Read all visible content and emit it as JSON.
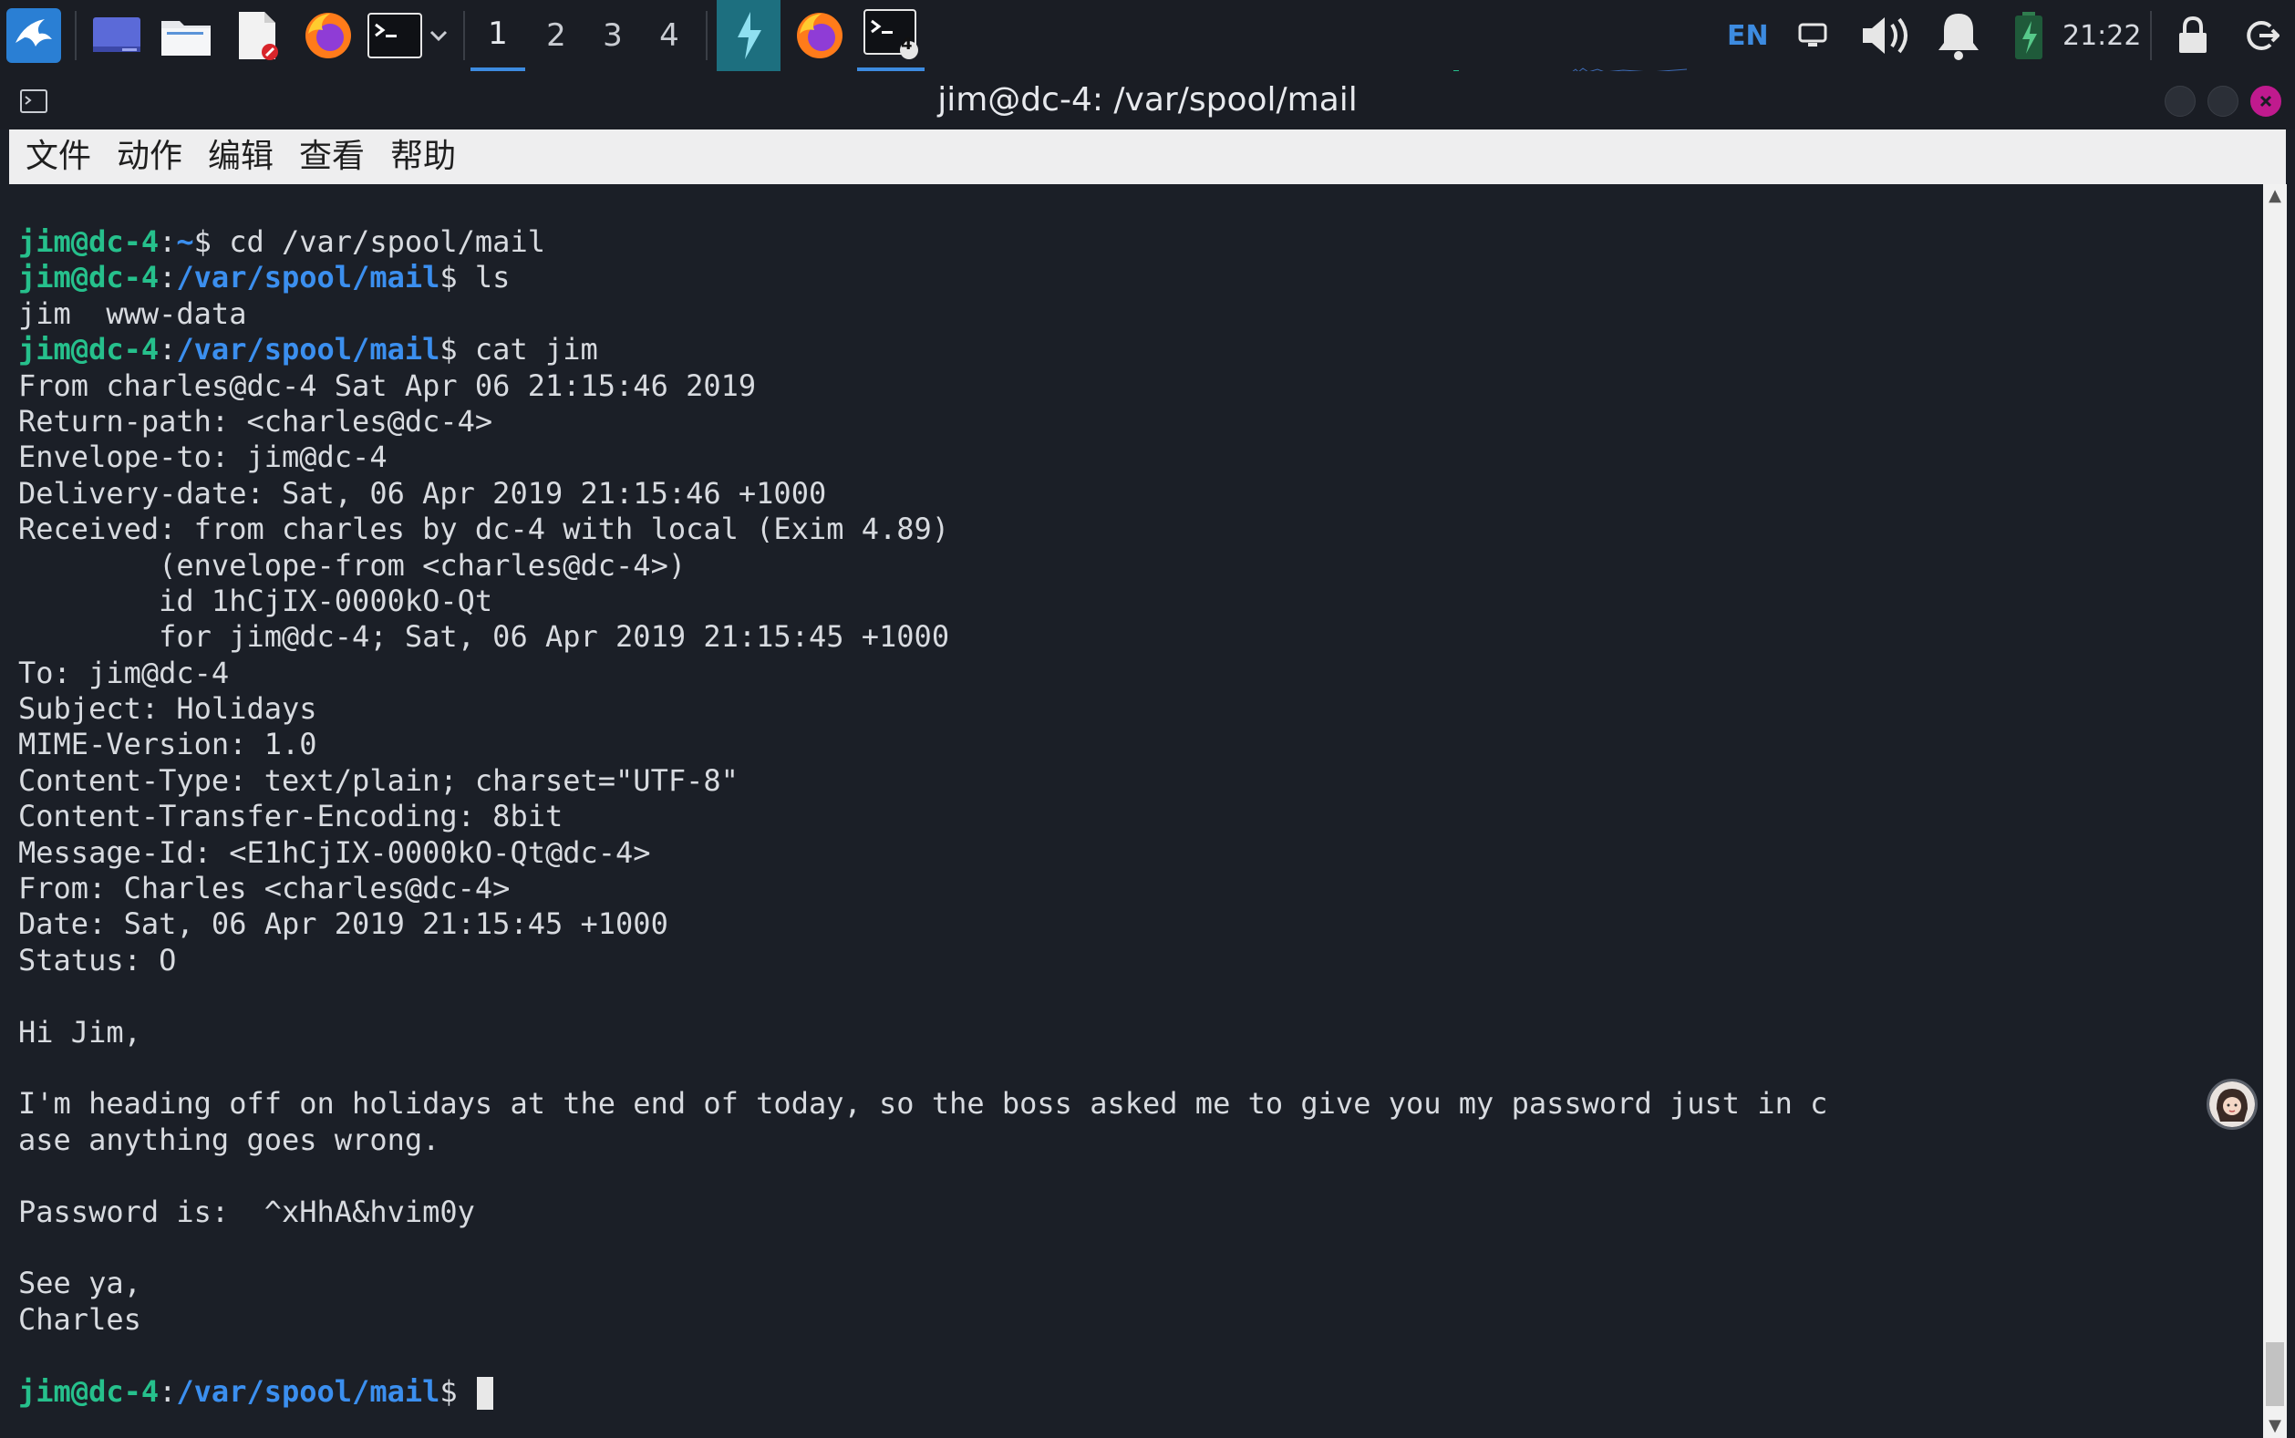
{
  "panel": {
    "workspaces": [
      "1",
      "2",
      "3",
      "4"
    ],
    "active_workspace": "1",
    "language": "EN",
    "clock": "21:22",
    "icons": [
      "kali-menu-icon",
      "desktop-icon",
      "file-manager-icon",
      "text-editor-icon",
      "firefox-icon",
      "terminal-icon",
      "chevron-down-icon",
      "bolt-icon",
      "firefox-window-icon",
      "terminal-window-icon",
      "display-icon",
      "volume-icon",
      "notification-bell-icon",
      "battery-icon",
      "lock-icon",
      "logout-icon"
    ],
    "terminal_badge": "4"
  },
  "window": {
    "title": "jim@dc-4: /var/spool/mail"
  },
  "menubar": {
    "file": "文件",
    "action": "动作",
    "edit": "编辑",
    "view": "查看",
    "help": "帮助"
  },
  "terminal": {
    "user_host": "jim@dc-4",
    "lines": [
      {
        "type": "prompt",
        "path": "~",
        "cmd": "cd /var/spool/mail"
      },
      {
        "type": "prompt",
        "path": "/var/spool/mail",
        "cmd": "ls"
      },
      {
        "type": "out",
        "text": "jim  www-data"
      },
      {
        "type": "prompt",
        "path": "/var/spool/mail",
        "cmd": "cat jim"
      },
      {
        "type": "out",
        "text": "From charles@dc-4 Sat Apr 06 21:15:46 2019"
      },
      {
        "type": "out",
        "text": "Return-path: <charles@dc-4>"
      },
      {
        "type": "out",
        "text": "Envelope-to: jim@dc-4"
      },
      {
        "type": "out",
        "text": "Delivery-date: Sat, 06 Apr 2019 21:15:46 +1000"
      },
      {
        "type": "out",
        "text": "Received: from charles by dc-4 with local (Exim 4.89)"
      },
      {
        "type": "out",
        "text": "        (envelope-from <charles@dc-4>)"
      },
      {
        "type": "out",
        "text": "        id 1hCjIX-0000kO-Qt"
      },
      {
        "type": "out",
        "text": "        for jim@dc-4; Sat, 06 Apr 2019 21:15:45 +1000"
      },
      {
        "type": "out",
        "text": "To: jim@dc-4"
      },
      {
        "type": "out",
        "text": "Subject: Holidays"
      },
      {
        "type": "out",
        "text": "MIME-Version: 1.0"
      },
      {
        "type": "out",
        "text": "Content-Type: text/plain; charset=\"UTF-8\""
      },
      {
        "type": "out",
        "text": "Content-Transfer-Encoding: 8bit"
      },
      {
        "type": "out",
        "text": "Message-Id: <E1hCjIX-0000kO-Qt@dc-4>"
      },
      {
        "type": "out",
        "text": "From: Charles <charles@dc-4>"
      },
      {
        "type": "out",
        "text": "Date: Sat, 06 Apr 2019 21:15:45 +1000"
      },
      {
        "type": "out",
        "text": "Status: O"
      },
      {
        "type": "out",
        "text": ""
      },
      {
        "type": "out",
        "text": "Hi Jim,"
      },
      {
        "type": "out",
        "text": ""
      },
      {
        "type": "out",
        "text": "I'm heading off on holidays at the end of today, so the boss asked me to give you my password just in c"
      },
      {
        "type": "out",
        "text": "ase anything goes wrong."
      },
      {
        "type": "out",
        "text": ""
      },
      {
        "type": "out",
        "text": "Password is:  ^xHhA&hvim0y"
      },
      {
        "type": "out",
        "text": ""
      },
      {
        "type": "out",
        "text": "See ya,"
      },
      {
        "type": "out",
        "text": "Charles"
      },
      {
        "type": "out",
        "text": ""
      },
      {
        "type": "prompt_cursor",
        "path": "/var/spool/mail",
        "cmd": ""
      }
    ]
  }
}
